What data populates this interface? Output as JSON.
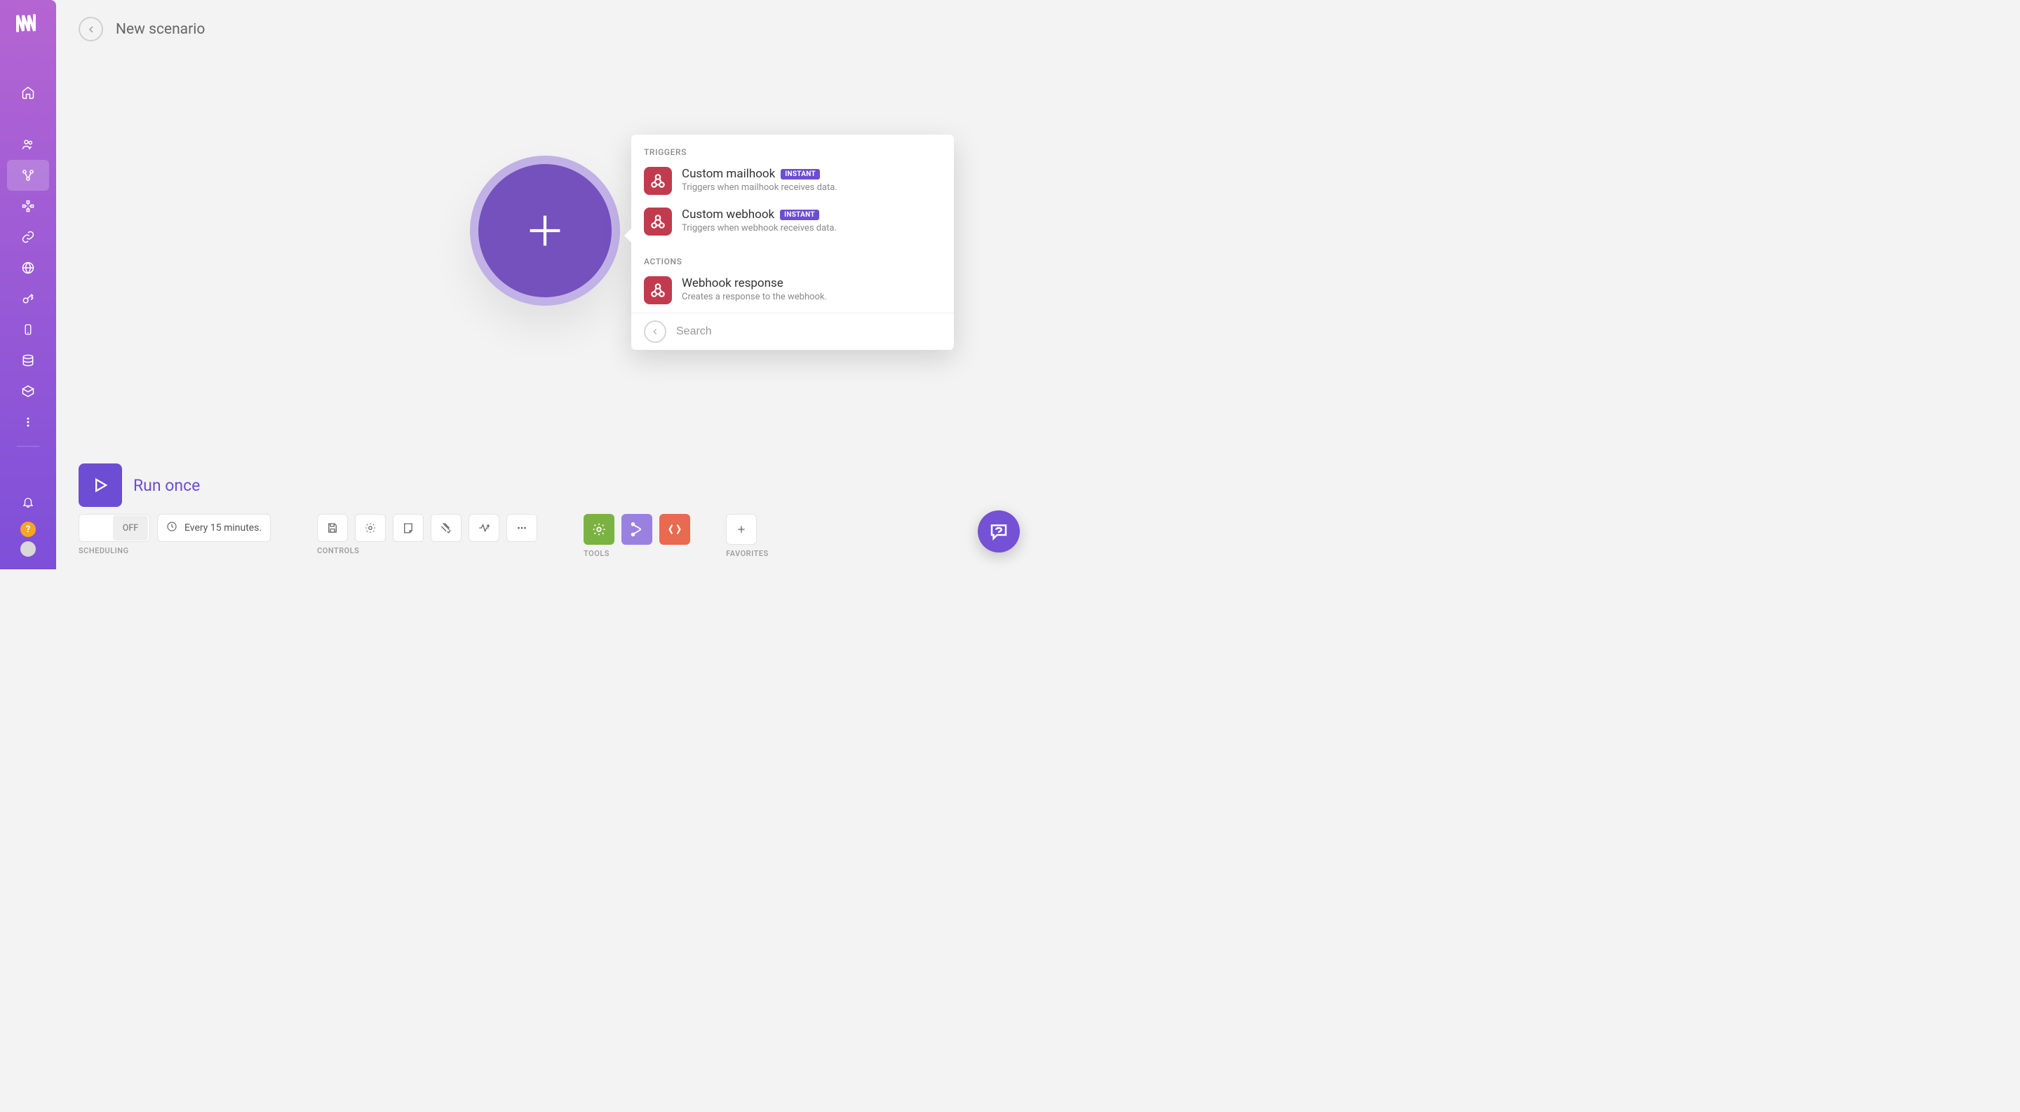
{
  "header": {
    "title": "New scenario"
  },
  "popup": {
    "section_triggers": "TRIGGERS",
    "section_actions": "ACTIONS",
    "items": [
      {
        "title": "Custom mailhook",
        "badge": "INSTANT",
        "desc": "Triggers when mailhook receives data."
      },
      {
        "title": "Custom webhook",
        "badge": "INSTANT",
        "desc": "Triggers when webhook receives data."
      }
    ],
    "actions": [
      {
        "title": "Webhook response",
        "desc": "Creates a response to the webhook."
      }
    ],
    "search_placeholder": "Search"
  },
  "run": {
    "label": "Run once"
  },
  "bottom": {
    "scheduling_label": "SCHEDULING",
    "toggle_state": "OFF",
    "schedule_text": "Every 15 minutes.",
    "controls_label": "CONTROLS",
    "tools_label": "TOOLS",
    "favorites_label": "FAVORITES"
  }
}
